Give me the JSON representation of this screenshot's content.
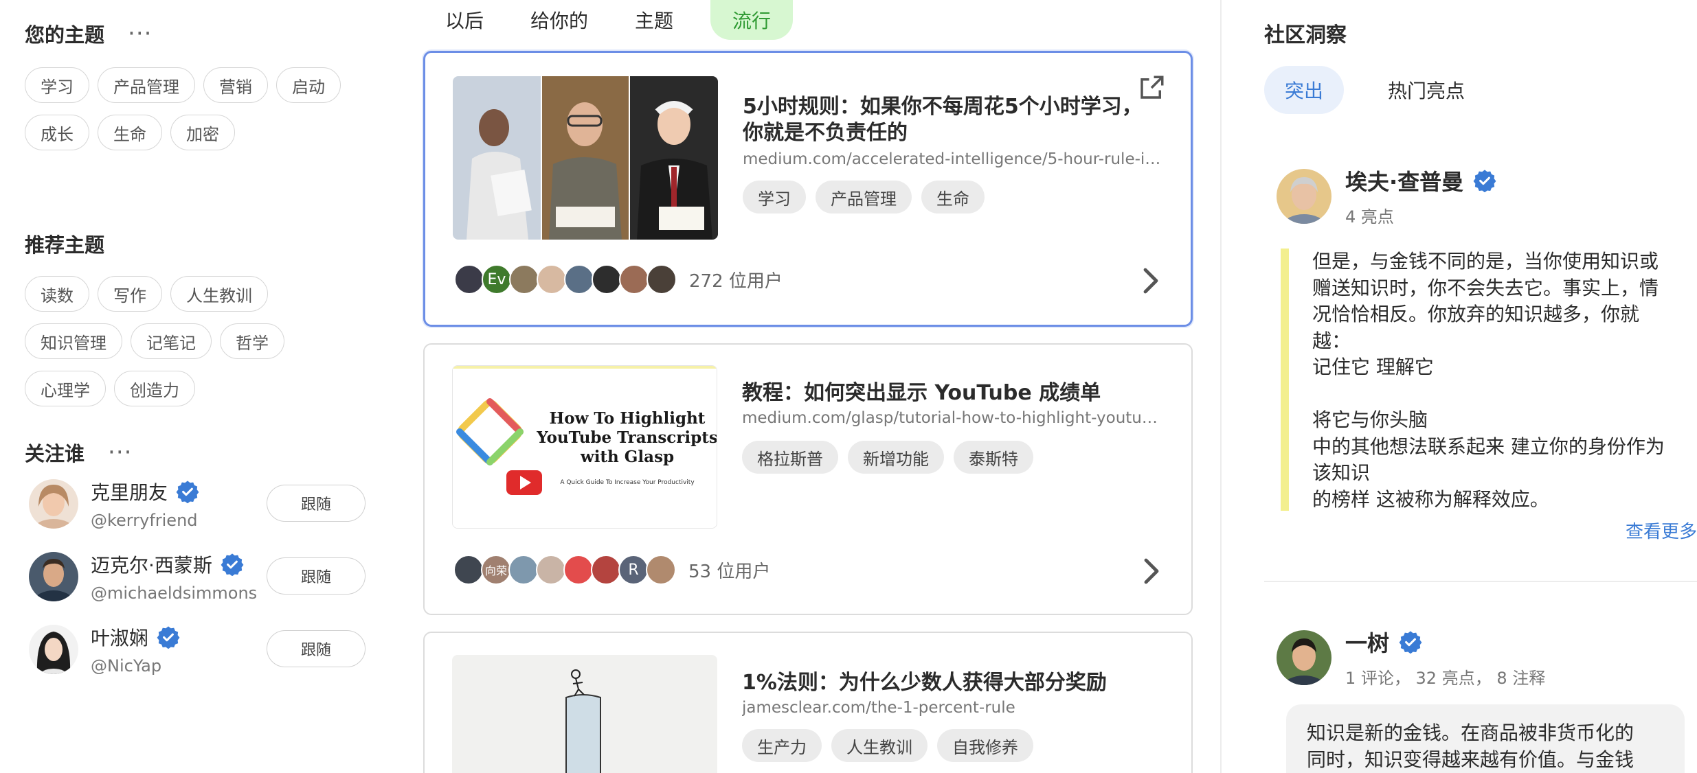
{
  "left": {
    "your_topics": {
      "title": "您的主题",
      "menu": "···",
      "tags": [
        "学习",
        "产品管理",
        "营销",
        "启动",
        "成长",
        "生命",
        "加密"
      ]
    },
    "recommended_topics": {
      "title": "推荐主题",
      "tags": [
        "读数",
        "写作",
        "人生教训",
        "知识管理",
        "记笔记",
        "哲学",
        "心理学",
        "创造力"
      ]
    },
    "who_to_follow": {
      "title": "关注谁",
      "menu": "···",
      "users": [
        {
          "name": "克里朋友",
          "handle": "@kerryfriend",
          "button": "跟随"
        },
        {
          "name": "迈克尔·西蒙斯",
          "handle": "@michaeldsimmons",
          "button": "跟随"
        },
        {
          "name": "叶淑娴",
          "handle": "@NicYap",
          "button": "跟随"
        }
      ]
    }
  },
  "feed": {
    "tabs": [
      "以后",
      "给你的",
      "主题",
      "流行"
    ],
    "active_tab": "流行",
    "cards": [
      {
        "title_lines": [
          "5小时规则：如果你不每周花5个小时学习，",
          "你就是不负责任的"
        ],
        "url": "medium.com/accelerated-intelligence/5-hour-rule-if-your...",
        "tags": [
          "学习",
          "产品管理",
          "生命"
        ],
        "avatar_labels": [
          "",
          "Ev",
          "",
          "",
          "",
          "",
          "",
          ""
        ],
        "users_count": "272 位用户"
      },
      {
        "title_lines": [
          "教程：如何突出显示 YouTube 成绩单"
        ],
        "url": "medium.com/glasp/tutorial-how-to-highlight-youtube-tra...",
        "tags": [
          "格拉斯普",
          "新增功能",
          "泰斯特"
        ],
        "thumb_heading": [
          "How To Highlight",
          "YouTube Transcripts",
          "with Glasp"
        ],
        "thumb_sub": "A Quick Guide To Increase Your Productivity",
        "avatar_labels": [
          "",
          "向荣",
          "",
          "",
          "",
          "",
          "R",
          ""
        ],
        "users_count": "53 位用户"
      },
      {
        "title_lines": [
          "1%法则：为什么少数人获得大部分奖励"
        ],
        "url": "jamesclear.com/the-1-percent-rule",
        "tags": [
          "生产力",
          "人生教训",
          "自我修养"
        ]
      }
    ]
  },
  "insights": {
    "title": "社区洞察",
    "tabs": [
      "突出",
      "热门亮点"
    ],
    "active_tab": "突出",
    "items": [
      {
        "name": "埃夫·查普曼",
        "meta": "4 亮点",
        "quote_lines": [
          "但是，与金钱不同的是，当你使用知识或",
          "赠送知识时，你不会失去它。事实上，情",
          "况恰恰相反。你放弃的知识越多，你就",
          "越：",
          "记住它 理解它",
          "",
          "将它与你头脑",
          "中的其他想法联系起来 建立你的身份作为",
          "该知识",
          "的榜样 这被称为解释效应。"
        ],
        "see_more": "查看更多"
      },
      {
        "name": "一树",
        "meta": "1 评论， 32 亮点， 8 注释",
        "bubble_lines": [
          "知识是新的金钱。在商品被非货币化的",
          "同时，知识变得越来越有价值。与金钱"
        ]
      }
    ]
  },
  "colors": {
    "accent_blue": "#3a7bd5",
    "active_tab_bg": "#d7f7d1",
    "active_tab_text": "#2f9a33",
    "highlight_bar": "#f3ef8e",
    "selected_border": "#6c8ee6"
  }
}
